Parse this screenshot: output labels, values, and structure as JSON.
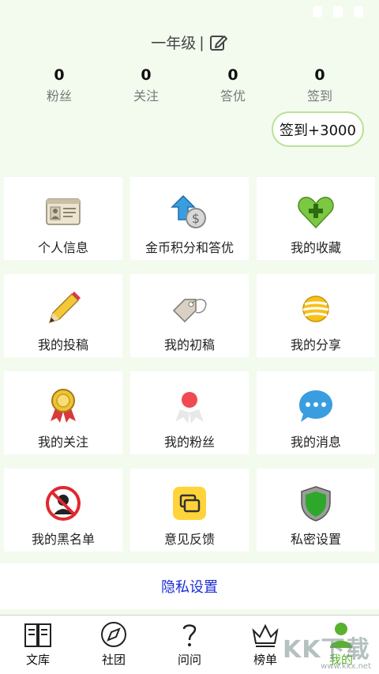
{
  "header": {
    "grade": "一年级",
    "separator": "|",
    "stats": [
      {
        "value": "0",
        "label": "粉丝"
      },
      {
        "value": "0",
        "label": "关注"
      },
      {
        "value": "0",
        "label": "答优"
      },
      {
        "value": "0",
        "label": "签到"
      }
    ],
    "checkin_label": "签到+3000"
  },
  "menu": [
    {
      "label": "个人信息",
      "icon": "id-card-icon"
    },
    {
      "label": "金币积分和答优",
      "icon": "coin-upgrade-icon"
    },
    {
      "label": "我的收藏",
      "icon": "heart-plus-icon"
    },
    {
      "label": "我的投稿",
      "icon": "pencil-icon"
    },
    {
      "label": "我的初稿",
      "icon": "tag-icon"
    },
    {
      "label": "我的分享",
      "icon": "share-ball-icon"
    },
    {
      "label": "我的关注",
      "icon": "medal-icon"
    },
    {
      "label": "我的粉丝",
      "icon": "ribbon-icon"
    },
    {
      "label": "我的消息",
      "icon": "chat-bubble-icon"
    },
    {
      "label": "我的黑名单",
      "icon": "blacklist-icon"
    },
    {
      "label": "意见反馈",
      "icon": "feedback-icon"
    },
    {
      "label": "私密设置",
      "icon": "shield-icon"
    }
  ],
  "privacy_link": "隐私设置",
  "tabs": [
    {
      "label": "文库",
      "icon": "book-icon"
    },
    {
      "label": "社团",
      "icon": "compass-icon"
    },
    {
      "label": "问问",
      "icon": "question-icon"
    },
    {
      "label": "榜单",
      "icon": "crown-icon"
    },
    {
      "label": "我的",
      "icon": "user-icon",
      "active": true
    }
  ],
  "watermark": {
    "text": "KK下载",
    "url": "www.kkx.net"
  },
  "colors": {
    "accent": "#59b22e",
    "link": "#1a2dd6",
    "background": "#f3fbef",
    "checkin_border": "#b8e296"
  }
}
